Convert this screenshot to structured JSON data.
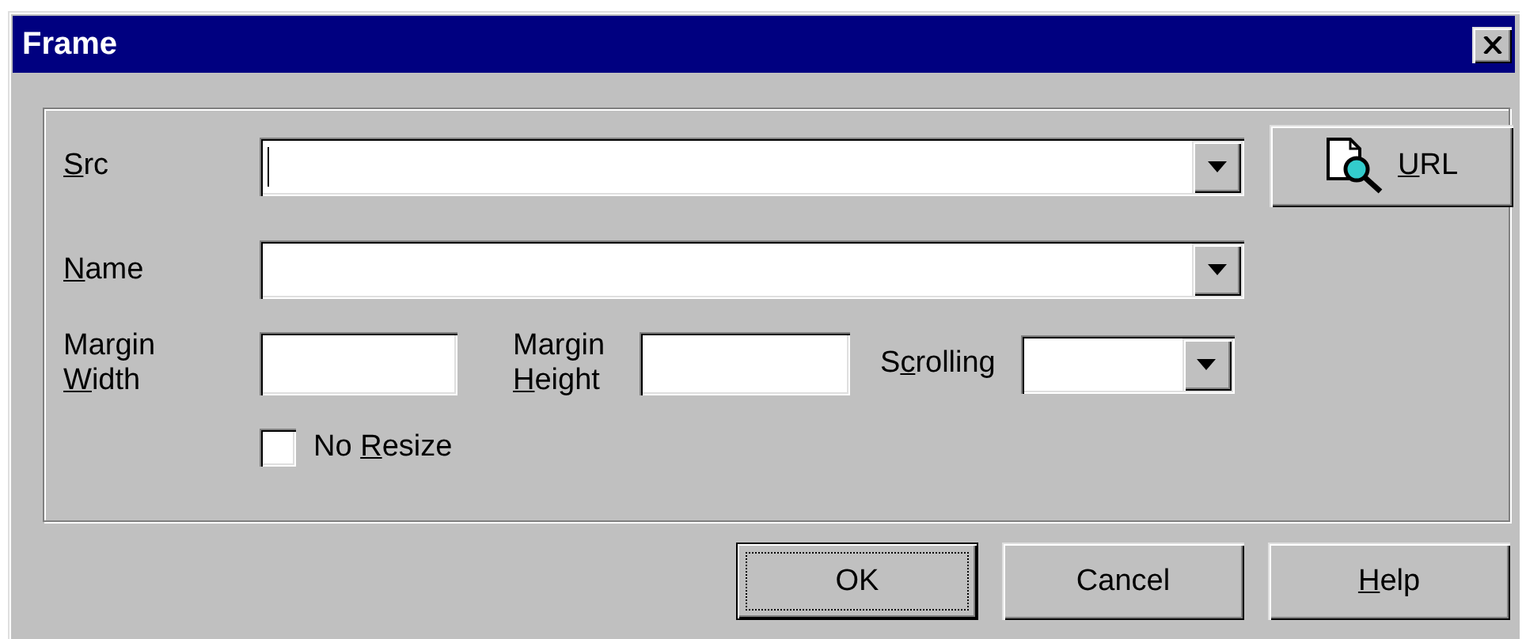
{
  "window": {
    "title": "Frame"
  },
  "src": {
    "label": [
      {
        "text": "S",
        "underlined": true
      },
      {
        "text": "rc",
        "underlined": false
      }
    ],
    "focused": true
  },
  "url_button": {
    "label": [
      {
        "text": "U",
        "underlined": true
      },
      {
        "text": "RL",
        "underlined": false
      }
    ]
  },
  "name": {
    "label": [
      {
        "text": "N",
        "underlined": true
      },
      {
        "text": "ame",
        "underlined": false
      }
    ],
    "focused": false
  },
  "margin_width": {
    "label": [
      {
        "text": "Margin ",
        "underlined": false
      },
      {
        "text": "W",
        "underlined": true
      },
      {
        "text": "idth",
        "underlined": false
      }
    ]
  },
  "margin_height": {
    "label": [
      {
        "text": "Margin ",
        "underlined": false
      },
      {
        "text": "H",
        "underlined": true
      },
      {
        "text": "eight",
        "underlined": false
      }
    ]
  },
  "scrolling": {
    "label": [
      {
        "text": "S",
        "underlined": false
      },
      {
        "text": "c",
        "underlined": true
      },
      {
        "text": "rolling",
        "underlined": false
      }
    ]
  },
  "no_resize": {
    "label": [
      {
        "text": "No ",
        "underlined": false
      },
      {
        "text": "R",
        "underlined": true
      },
      {
        "text": "esize",
        "underlined": false
      }
    ],
    "checked": false
  },
  "buttons": [
    {
      "label": [
        {
          "text": "OK",
          "underlined": false
        }
      ],
      "default": true
    },
    {
      "label": [
        {
          "text": "Cancel",
          "underlined": false
        }
      ],
      "default": false
    },
    {
      "label": [
        {
          "text": "H",
          "underlined": true
        },
        {
          "text": "elp",
          "underlined": false
        }
      ],
      "default": false
    }
  ]
}
